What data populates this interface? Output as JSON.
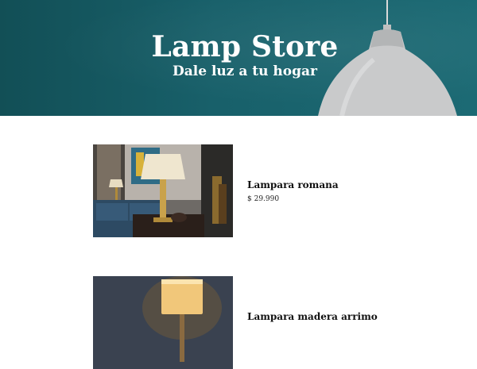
{
  "hero": {
    "title": "Lamp Store",
    "subtitle": "Dale luz a tu hogar",
    "background_color": "#18606a"
  },
  "products": [
    {
      "name": "Lampara romana",
      "price": "$ 29.990",
      "image": "living-room-table-lamp-photo"
    },
    {
      "name": "Lampara madera arrimo",
      "price": "",
      "image": "shaded-lamp-photo"
    }
  ]
}
